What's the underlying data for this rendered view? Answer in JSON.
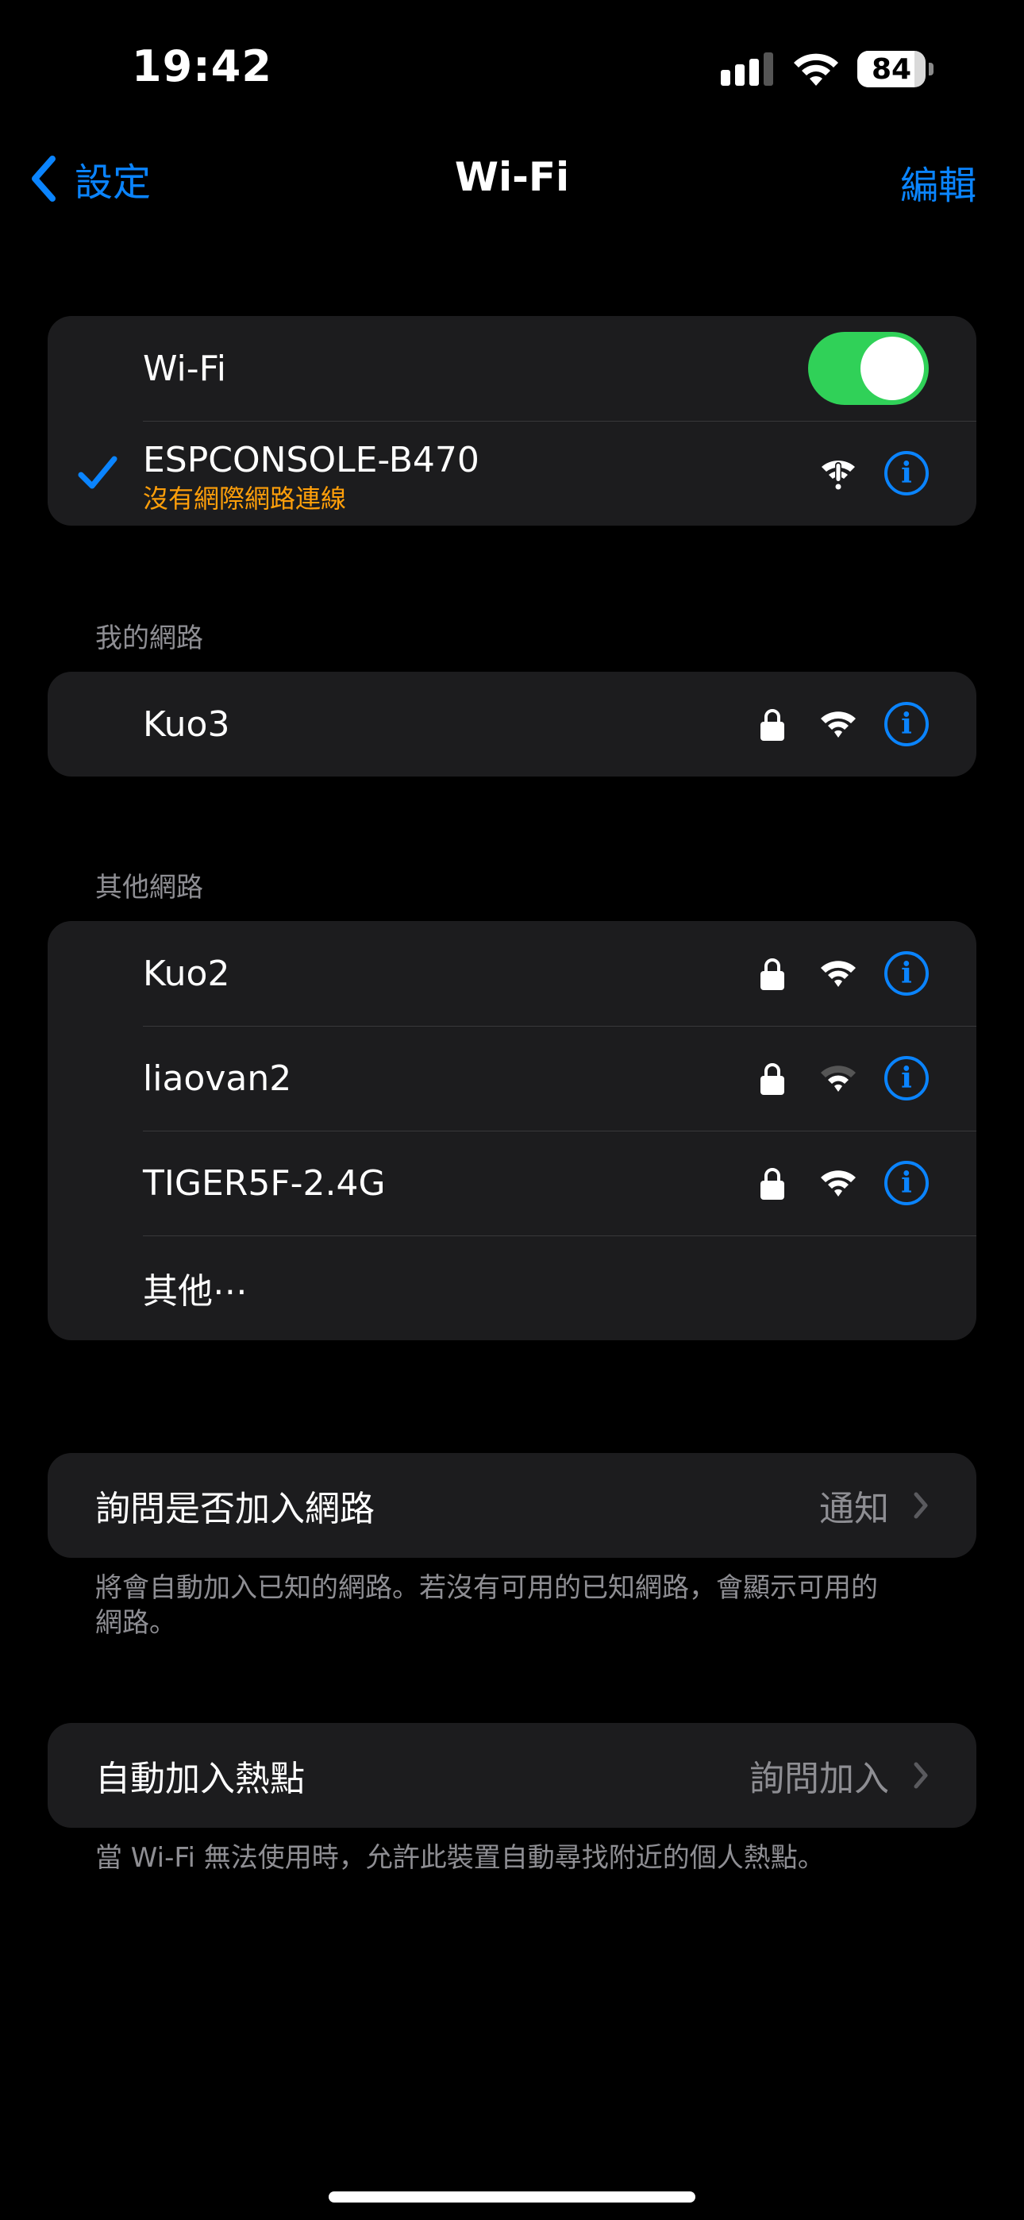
{
  "status_bar": {
    "time": "19:42",
    "battery": "84"
  },
  "nav": {
    "back_label": "設定",
    "title": "Wi-Fi",
    "edit_label": "編輯"
  },
  "wifi_group": {
    "toggle_label": "Wi-Fi",
    "toggle_on": true,
    "connected": {
      "name": "ESPCONSOLE-B470",
      "status": "沒有網際網路連線"
    }
  },
  "my_networks": {
    "header": "我的網路",
    "items": [
      {
        "name": "Kuo3"
      }
    ]
  },
  "other_networks": {
    "header": "其他網路",
    "items": [
      {
        "name": "Kuo2"
      },
      {
        "name": "liaovan2"
      },
      {
        "name": "TIGER5F-2.4G"
      }
    ],
    "other_label": "其他⋯"
  },
  "ask_to_join": {
    "label": "詢問是否加入網路",
    "value": "通知",
    "footnote": "將會自動加入已知的網路。若沒有可用的已知網路，會顯示可用的網路。"
  },
  "auto_join_hotspot": {
    "label": "自動加入熱點",
    "value": "詢問加入",
    "footnote": "當 Wi-Fi 無法使用時，允許此裝置自動尋找附近的個人熱點。"
  },
  "colors": {
    "accent": "#0a84ff",
    "toggle_on": "#30d158",
    "warning": "#ff9f0a",
    "group_bg": "#1c1c1e"
  }
}
